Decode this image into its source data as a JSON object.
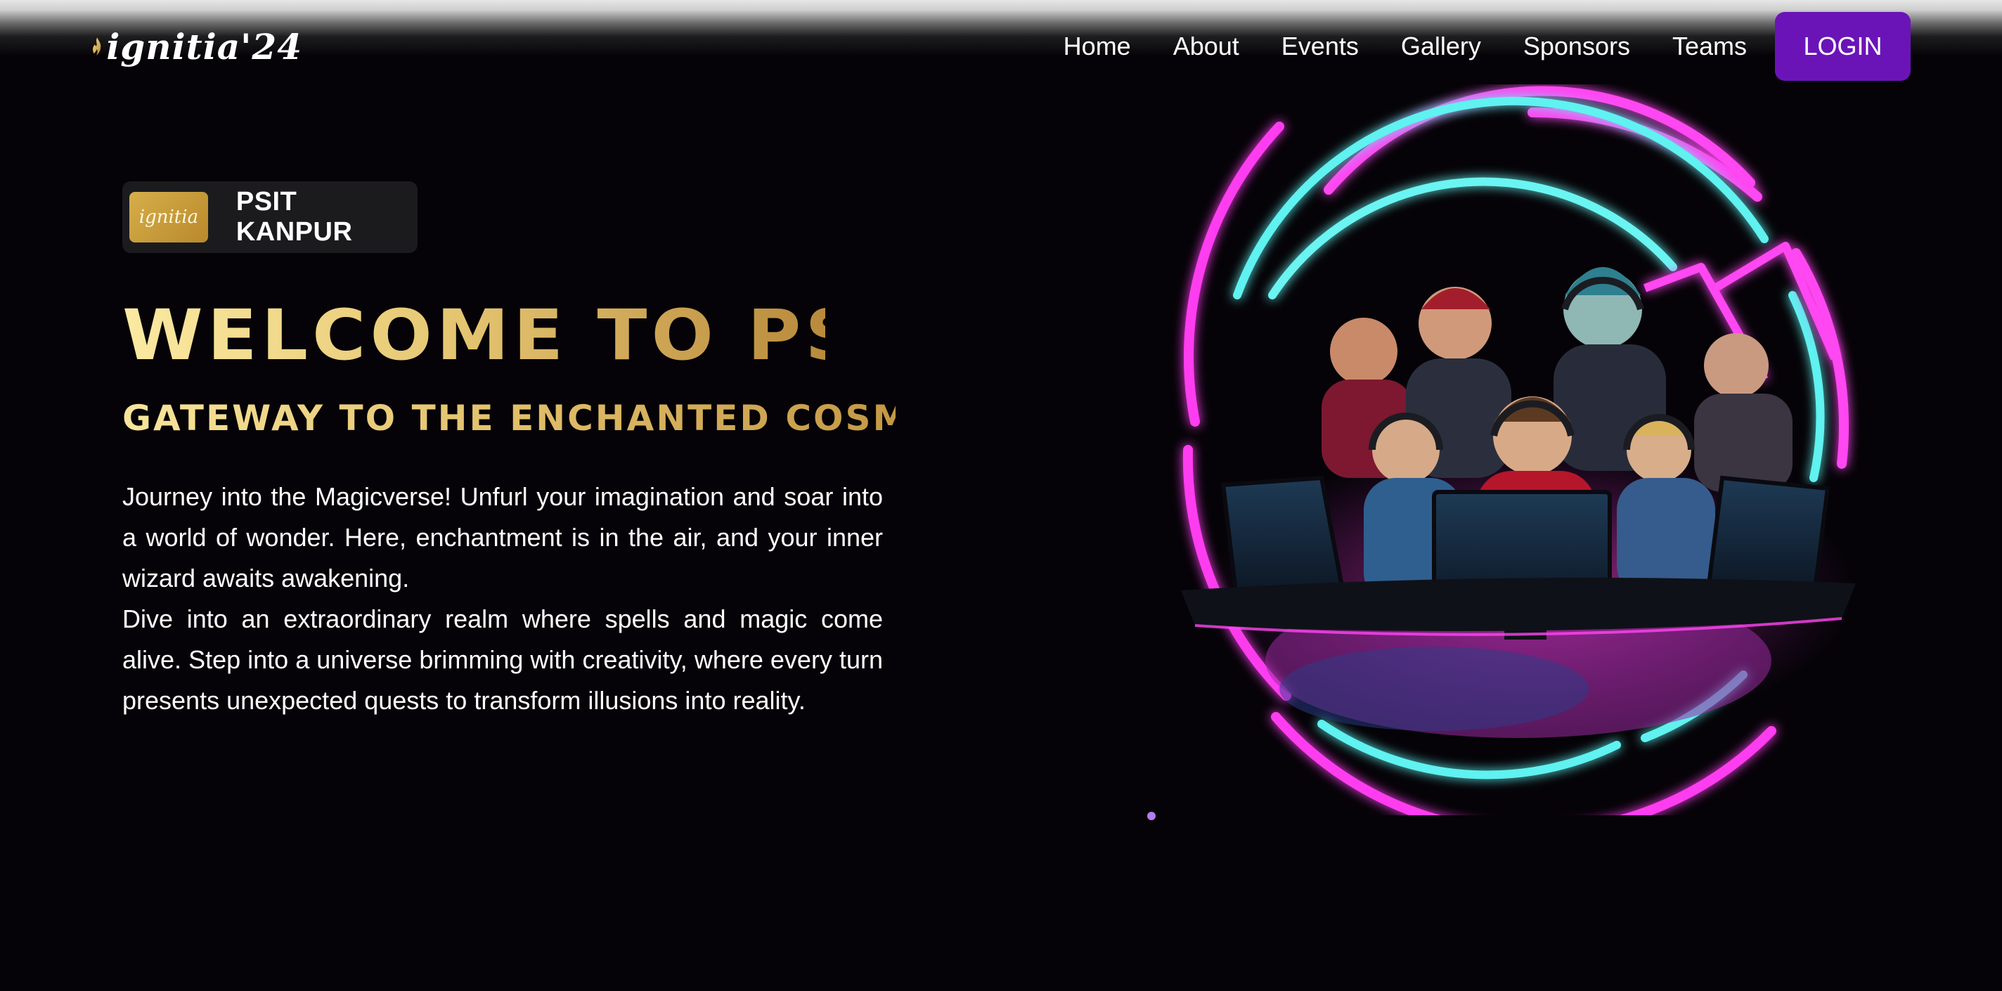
{
  "brand": {
    "logo_text": "ignitia'24",
    "badge_logo_text": "ignitia"
  },
  "nav": {
    "items": [
      "Home",
      "About",
      "Events",
      "Gallery",
      "Sponsors",
      "Teams"
    ],
    "login_label": "LOGIN"
  },
  "hero": {
    "badge_label": "PSIT KANPUR",
    "title": "WELCOME TO PSIT",
    "subtitle": "GATEWAY TO THE ENCHANTED COSMOS!",
    "paragraph_1": "Journey into the Magicverse! Unfurl your imagination and soar into a world of wonder. Here, enchantment is in the air, and your inner wizard awaits awakening.",
    "paragraph_2": "Dive into an extraordinary realm where spells and magic come alive. Step into a universe brimming with creativity, where every turn presents unexpected quests to transform illusions into reality."
  },
  "colors": {
    "background": "#050307",
    "accent_purple": "#6a14b8",
    "gold": "#e6c874",
    "neon_pink": "#ff3cf0",
    "neon_cyan": "#5ff2f0"
  },
  "icons": {
    "logo": "flame-icon",
    "hero_art": "gamers-neon-ring-illustration"
  }
}
